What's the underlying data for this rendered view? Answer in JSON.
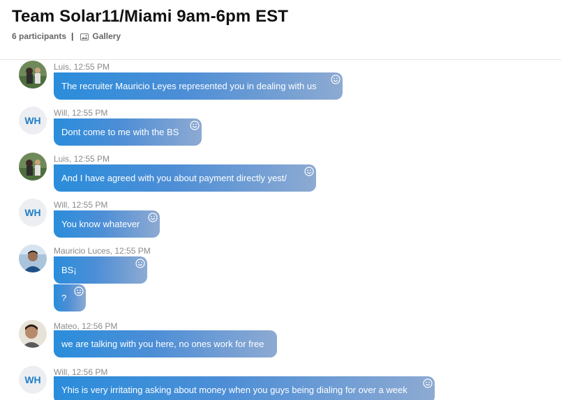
{
  "header": {
    "title": "Team Solar11/Miami 9am-6pm EST",
    "participants": "6 participants",
    "separator": "|",
    "gallery_label": "Gallery"
  },
  "messages": [
    {
      "sender": "Luis",
      "meta": "Luis, 12:55 PM",
      "avatar": "photo",
      "texts": [
        "The recruiter Mauricio Leyes represented you in dealing with us"
      ]
    },
    {
      "sender": "Will",
      "meta": "Will, 12:55 PM",
      "avatar": "WH",
      "texts": [
        "Dont come to me with the BS"
      ]
    },
    {
      "sender": "Luis",
      "meta": "Luis, 12:55 PM",
      "avatar": "photo",
      "texts": [
        "And I have agreed with you about payment directly yest/"
      ]
    },
    {
      "sender": "Will",
      "meta": "Will, 12:55 PM",
      "avatar": "WH",
      "texts": [
        "You know whatever"
      ]
    },
    {
      "sender": "Mauricio Luces",
      "meta": "Mauricio Luces, 12:55 PM",
      "avatar": "photo",
      "texts": [
        "BS¡",
        "?"
      ]
    },
    {
      "sender": "Mateo",
      "meta": "Mateo, 12:56 PM",
      "avatar": "photo",
      "texts": [
        "we are talking with you here, no ones work for free"
      ]
    },
    {
      "sender": "Will",
      "meta": "Will, 12:56 PM",
      "avatar": "WH",
      "texts": [
        "Yhis is very irritating asking about money when you guys being dialing for over a week"
      ]
    }
  ],
  "colors": {
    "bubble_start": "#2a8ddb",
    "bubble_end": "#8daad2",
    "initials_text": "#1f7ec6",
    "initials_bg": "#eceef2"
  },
  "icons": {
    "gallery": "gallery-icon",
    "reaction": "smiley-icon"
  }
}
